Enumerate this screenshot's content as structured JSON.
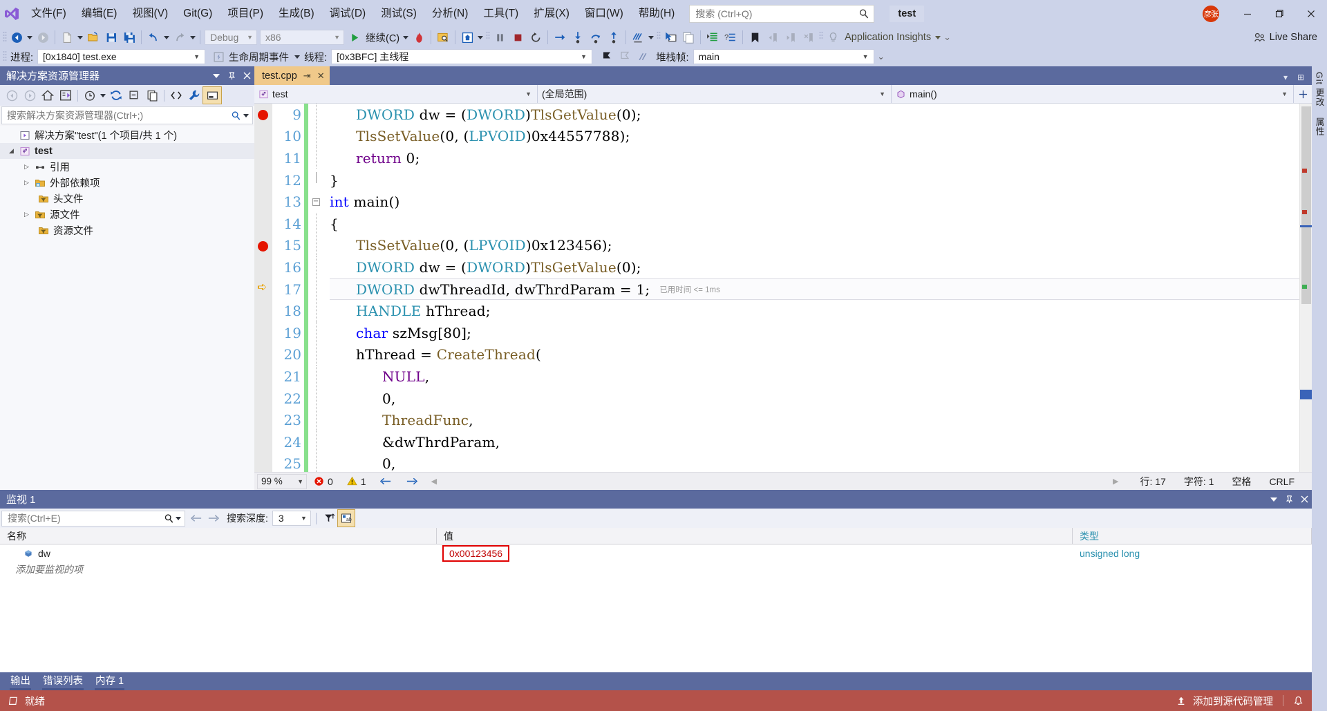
{
  "window": {
    "solution_name": "test",
    "account_initials": "彦张",
    "minimize": "—",
    "maximize": "❐",
    "close": "✕"
  },
  "menu": {
    "items": [
      {
        "text": "文件(F)"
      },
      {
        "text": "编辑(E)"
      },
      {
        "text": "视图(V)"
      },
      {
        "text": "Git(G)"
      },
      {
        "text": "项目(P)"
      },
      {
        "text": "生成(B)"
      },
      {
        "text": "调试(D)"
      },
      {
        "text": "测试(S)"
      },
      {
        "text": "分析(N)"
      },
      {
        "text": "工具(T)"
      },
      {
        "text": "扩展(X)"
      },
      {
        "text": "窗口(W)"
      },
      {
        "text": "帮助(H)"
      }
    ]
  },
  "search": {
    "placeholder": "搜索 (Ctrl+Q)",
    "value": ""
  },
  "toolbar": {
    "config_value": "Debug",
    "platform_value": "x86",
    "continue_label": "继续(C)",
    "insights_label": "Application Insights",
    "live_share_label": "Live Share"
  },
  "debug_bar": {
    "process_label": "进程:",
    "process_value": "[0x1840] test.exe",
    "lifecycle_label": "生命周期事件",
    "thread_label": "线程:",
    "thread_value": "[0x3BFC] 主线程",
    "stackframe_label": "堆栈帧:",
    "stackframe_value": "main"
  },
  "solution_explorer": {
    "title": "解决方案资源管理器",
    "search_placeholder": "搜索解决方案资源管理器(Ctrl+;)",
    "tree": [
      {
        "label": "解决方案\"test\"(1 个项目/共 1 个)",
        "icon": "solution-icon",
        "indent": 1,
        "twisty": "",
        "bold": false
      },
      {
        "label": "test",
        "icon": "project-icon",
        "indent": 1,
        "twisty": "▲",
        "bold": true
      },
      {
        "label": "引用",
        "icon": "references-icon",
        "indent": 2,
        "twisty": "▶",
        "bold": false
      },
      {
        "label": "外部依赖项",
        "icon": "folder-ext-icon",
        "indent": 2,
        "twisty": "▶",
        "bold": false
      },
      {
        "label": "头文件",
        "icon": "folder-filter-icon",
        "indent": 3,
        "twisty": "",
        "bold": false
      },
      {
        "label": "源文件",
        "icon": "folder-filter-icon",
        "indent": 2,
        "twisty": "▶",
        "bold": false
      },
      {
        "label": "资源文件",
        "icon": "folder-filter-icon",
        "indent": 3,
        "twisty": "",
        "bold": false
      }
    ]
  },
  "editor": {
    "tab_label": "test.cpp",
    "nav_project": "test",
    "nav_scope": "(全局范围)",
    "nav_member": "main()",
    "zoom": "99 %",
    "error_count": "0",
    "warning_count": "1",
    "line_label": "行: 17",
    "col_label": "字符: 1",
    "spaces_label": "空格",
    "eol_label": "CRLF",
    "elapsed_tip": "已用时间 <= 1ms",
    "lines": [
      {
        "num": "9",
        "breakpoint": true,
        "current": false,
        "fold": "",
        "indent": 1,
        "tokens": [
          {
            "t": "DWORD",
            "c": "c-type"
          },
          {
            "t": " dw = (",
            "c": "c-plain"
          },
          {
            "t": "DWORD",
            "c": "c-type"
          },
          {
            "t": ")",
            "c": "c-plain"
          },
          {
            "t": "TlsGetValue",
            "c": "c-fn"
          },
          {
            "t": "(0);",
            "c": "c-plain"
          }
        ]
      },
      {
        "num": "10",
        "breakpoint": false,
        "current": false,
        "fold": "",
        "indent": 1,
        "tokens": [
          {
            "t": "TlsSetValue",
            "c": "c-fn"
          },
          {
            "t": "(0, (",
            "c": "c-plain"
          },
          {
            "t": "LPVOID",
            "c": "c-type"
          },
          {
            "t": ")0x44557788);",
            "c": "c-plain"
          }
        ]
      },
      {
        "num": "11",
        "breakpoint": false,
        "current": false,
        "fold": "",
        "indent": 1,
        "tokens": [
          {
            "t": "return",
            "c": "c-macro"
          },
          {
            "t": " 0;",
            "c": "c-plain"
          }
        ]
      },
      {
        "num": "12",
        "breakpoint": false,
        "current": false,
        "fold": "end",
        "indent": 0,
        "tokens": [
          {
            "t": "}",
            "c": "c-plain"
          }
        ]
      },
      {
        "num": "13",
        "breakpoint": false,
        "current": false,
        "fold": "start",
        "indent": 0,
        "tokens": [
          {
            "t": "int",
            "c": "c-kw"
          },
          {
            "t": " main()",
            "c": "c-plain"
          }
        ]
      },
      {
        "num": "14",
        "breakpoint": false,
        "current": false,
        "fold": "",
        "indent": 0,
        "tokens": [
          {
            "t": "{",
            "c": "c-plain"
          }
        ]
      },
      {
        "num": "15",
        "breakpoint": true,
        "current": false,
        "fold": "",
        "indent": 1,
        "tokens": [
          {
            "t": "TlsSetValue",
            "c": "c-fn"
          },
          {
            "t": "(0, (",
            "c": "c-plain"
          },
          {
            "t": "LPVOID",
            "c": "c-type"
          },
          {
            "t": ")0x123456);",
            "c": "c-plain"
          }
        ]
      },
      {
        "num": "16",
        "breakpoint": false,
        "current": false,
        "fold": "",
        "indent": 1,
        "tokens": [
          {
            "t": "DWORD",
            "c": "c-type"
          },
          {
            "t": " dw = (",
            "c": "c-plain"
          },
          {
            "t": "DWORD",
            "c": "c-type"
          },
          {
            "t": ")",
            "c": "c-plain"
          },
          {
            "t": "TlsGetValue",
            "c": "c-fn"
          },
          {
            "t": "(0);",
            "c": "c-plain"
          }
        ]
      },
      {
        "num": "17",
        "breakpoint": false,
        "current": true,
        "fold": "",
        "indent": 1,
        "tokens": [
          {
            "t": "DWORD",
            "c": "c-type"
          },
          {
            "t": " dwThreadId, dwThrdParam = 1;",
            "c": "c-plain"
          }
        ]
      },
      {
        "num": "18",
        "breakpoint": false,
        "current": false,
        "fold": "",
        "indent": 1,
        "tokens": [
          {
            "t": "HANDLE",
            "c": "c-type"
          },
          {
            "t": " hThread;",
            "c": "c-plain"
          }
        ]
      },
      {
        "num": "19",
        "breakpoint": false,
        "current": false,
        "fold": "",
        "indent": 1,
        "tokens": [
          {
            "t": "char",
            "c": "c-kw"
          },
          {
            "t": " szMsg[80];",
            "c": "c-plain"
          }
        ]
      },
      {
        "num": "20",
        "breakpoint": false,
        "current": false,
        "fold": "",
        "indent": 1,
        "tokens": [
          {
            "t": "hThread = ",
            "c": "c-plain"
          },
          {
            "t": "CreateThread",
            "c": "c-fn"
          },
          {
            "t": "(",
            "c": "c-plain"
          }
        ]
      },
      {
        "num": "21",
        "breakpoint": false,
        "current": false,
        "fold": "",
        "indent": 2,
        "tokens": [
          {
            "t": "NULL",
            "c": "c-macro"
          },
          {
            "t": ",",
            "c": "c-plain"
          }
        ]
      },
      {
        "num": "22",
        "breakpoint": false,
        "current": false,
        "fold": "",
        "indent": 2,
        "tokens": [
          {
            "t": "0,",
            "c": "c-plain"
          }
        ]
      },
      {
        "num": "23",
        "breakpoint": false,
        "current": false,
        "fold": "",
        "indent": 2,
        "tokens": [
          {
            "t": "ThreadFunc",
            "c": "c-fn"
          },
          {
            "t": ",",
            "c": "c-plain"
          }
        ]
      },
      {
        "num": "24",
        "breakpoint": false,
        "current": false,
        "fold": "",
        "indent": 2,
        "tokens": [
          {
            "t": "&dwThrdParam,",
            "c": "c-plain"
          }
        ]
      },
      {
        "num": "25",
        "breakpoint": false,
        "current": false,
        "fold": "",
        "indent": 2,
        "tokens": [
          {
            "t": "0,",
            "c": "c-plain"
          }
        ]
      }
    ]
  },
  "watch": {
    "title": "监视 1",
    "search_placeholder": "搜索(Ctrl+E)",
    "depth_label": "搜索深度:",
    "depth_value": "3",
    "columns": [
      "名称",
      "值",
      "类型"
    ],
    "rows": [
      {
        "name": "dw",
        "value": "0x00123456",
        "type": "unsigned long",
        "highlight": true
      }
    ],
    "add_row_placeholder": "添加要监视的项"
  },
  "bottom_tabs": {
    "items": [
      {
        "label": "输出"
      },
      {
        "label": "错误列表"
      },
      {
        "label": "内存 1"
      }
    ]
  },
  "status_bar": {
    "state": "就绪",
    "source_control": "添加到源代码管理"
  },
  "right_rail": {
    "items": [
      {
        "label": "Git 更改"
      },
      {
        "label": "属性"
      }
    ]
  },
  "colors": {
    "chrome": "#ccd3e9",
    "panel_header": "#5b6a9e",
    "tab_active": "#f0c98a",
    "status_debug": "#b4524a",
    "breakpoint": "#e51400",
    "change_bar": "#88e08c",
    "accent_blue": "#2b91af"
  }
}
